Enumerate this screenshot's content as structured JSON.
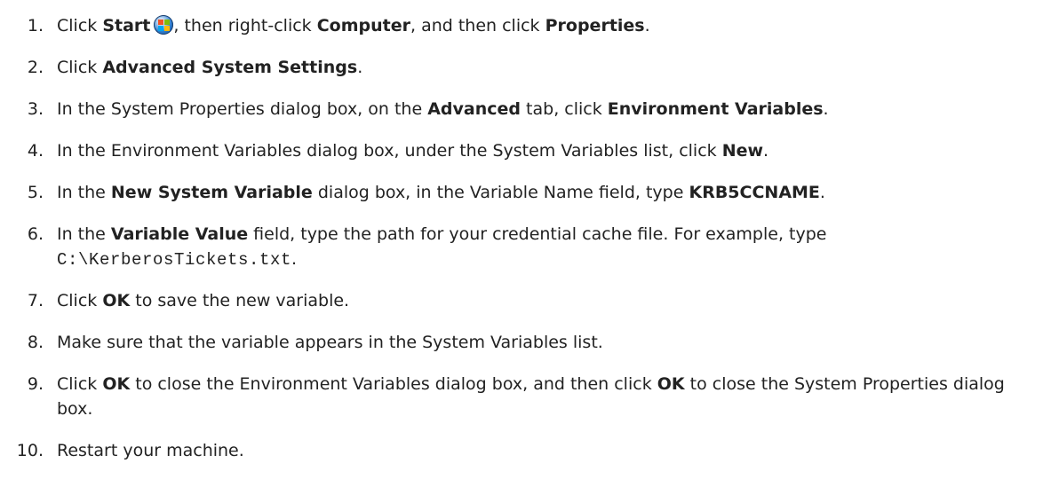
{
  "steps": [
    {
      "number": "1.",
      "parts": [
        {
          "text": "Click "
        },
        {
          "text": "Start",
          "bold": true
        },
        {
          "icon": "windows-start-orb-icon"
        },
        {
          "text": ", then right-click "
        },
        {
          "text": "Computer",
          "bold": true
        },
        {
          "text": ", and then click "
        },
        {
          "text": "Properties",
          "bold": true
        },
        {
          "text": "."
        }
      ]
    },
    {
      "number": "2.",
      "parts": [
        {
          "text": "Click "
        },
        {
          "text": "Advanced System Settings",
          "bold": true
        },
        {
          "text": "."
        }
      ]
    },
    {
      "number": "3.",
      "parts": [
        {
          "text": "In the System Properties dialog box, on the "
        },
        {
          "text": "Advanced",
          "bold": true
        },
        {
          "text": " tab, click "
        },
        {
          "text": "Environment Variables",
          "bold": true
        },
        {
          "text": "."
        }
      ]
    },
    {
      "number": "4.",
      "parts": [
        {
          "text": "In the Environment Variables dialog box, under the System Variables list, click "
        },
        {
          "text": "New",
          "bold": true
        },
        {
          "text": "."
        }
      ]
    },
    {
      "number": "5.",
      "parts": [
        {
          "text": "In the "
        },
        {
          "text": "New System Variable",
          "bold": true
        },
        {
          "text": " dialog box, in the Variable Name field, type "
        },
        {
          "text": "KRB5CCNAME",
          "bold": true
        },
        {
          "text": "."
        }
      ]
    },
    {
      "number": "6.",
      "parts": [
        {
          "text": "In the "
        },
        {
          "text": "Variable Value",
          "bold": true
        },
        {
          "text": " field, type the path for your credential cache file. For example, type "
        },
        {
          "text": "C:\\KerberosTickets.txt",
          "code": true
        },
        {
          "text": "."
        }
      ]
    },
    {
      "number": "7.",
      "parts": [
        {
          "text": "Click "
        },
        {
          "text": "OK",
          "bold": true
        },
        {
          "text": " to save the new variable."
        }
      ]
    },
    {
      "number": "8.",
      "parts": [
        {
          "text": "Make sure that the variable appears in the System Variables list."
        }
      ]
    },
    {
      "number": "9.",
      "parts": [
        {
          "text": "Click "
        },
        {
          "text": "OK",
          "bold": true
        },
        {
          "text": " to close the Environment Variables dialog box, and then click "
        },
        {
          "text": "OK",
          "bold": true
        },
        {
          "text": " to close the System Properties dialog box."
        }
      ]
    },
    {
      "number": "10.",
      "parts": [
        {
          "text": "Restart your machine."
        }
      ]
    }
  ]
}
